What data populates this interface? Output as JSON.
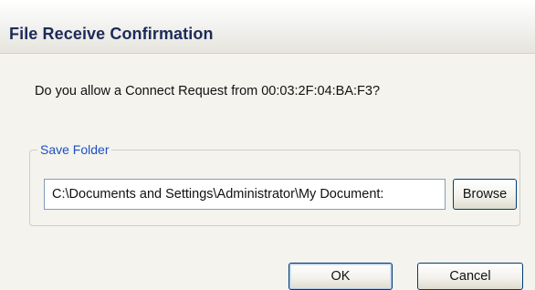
{
  "window": {
    "title": "File Receive Confirmation"
  },
  "dialog": {
    "question": "Do you allow a Connect Request from 00:03:2F:04:BA:F3?"
  },
  "save_folder": {
    "legend": "Save Folder",
    "path_value": "C:\\Documents and Settings\\Administrator\\My Document:",
    "browse_label": "Browse"
  },
  "buttons": {
    "ok_label": "OK",
    "cancel_label": "Cancel"
  }
}
